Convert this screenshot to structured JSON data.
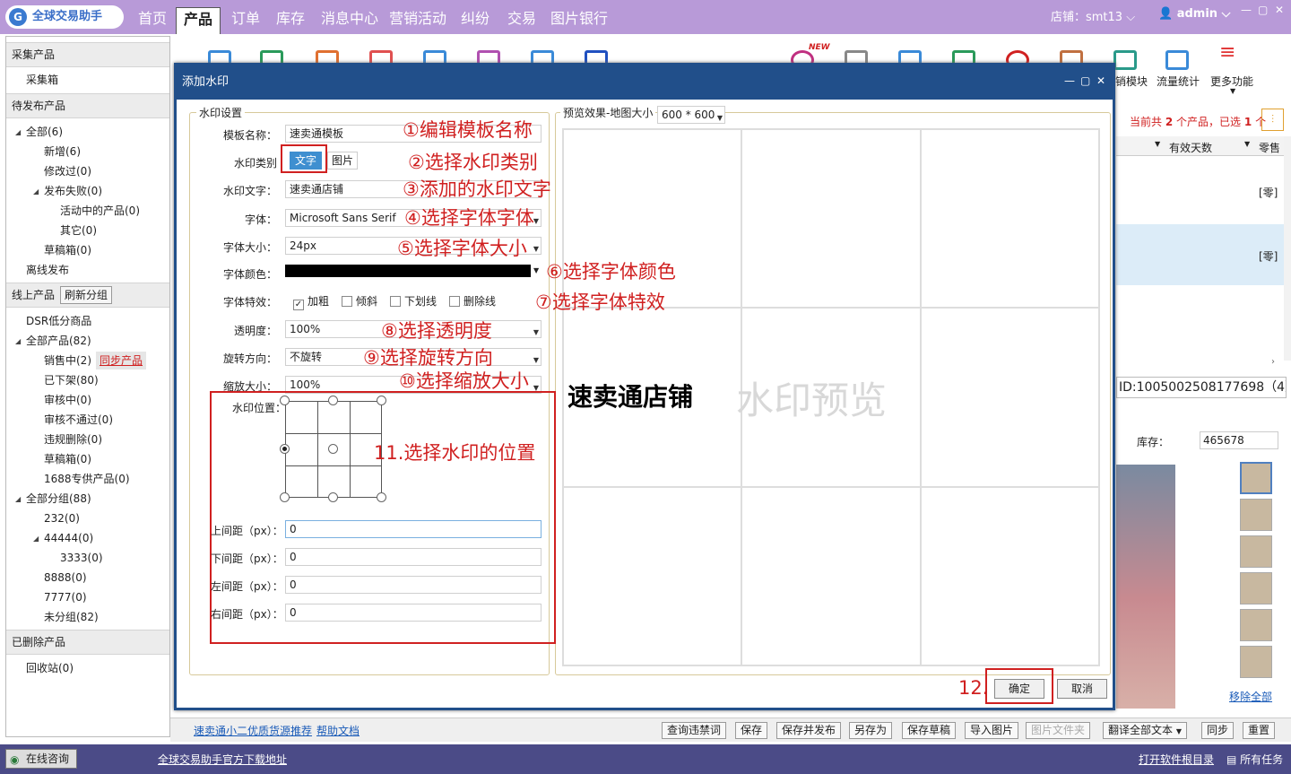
{
  "app": {
    "logo_text": "全球交易助手"
  },
  "nav": {
    "tabs": [
      {
        "label": "首页"
      },
      {
        "label": "产品"
      },
      {
        "label": "订单"
      },
      {
        "label": "库存"
      },
      {
        "label": "消息中心"
      },
      {
        "label": "营销活动"
      },
      {
        "label": "纠纷"
      },
      {
        "label": "交易"
      },
      {
        "label": "图片银行"
      }
    ]
  },
  "header": {
    "shop": "店铺：smt13",
    "user": "admin"
  },
  "sidebar": {
    "collect": {
      "title": "采集产品",
      "items": [
        "采集箱"
      ]
    },
    "pending": {
      "title": "待发布产品",
      "all": "全部(6)",
      "new": "新增(6)",
      "modified": "修改过(0)",
      "failed": "发布失败(0)",
      "active": "活动中的产品(0)",
      "other": "其它(0)",
      "draft": "草稿箱(0)",
      "offline": "离线发布"
    },
    "online": {
      "title": "线上产品",
      "refresh_btn": "刷新分组",
      "dsr": "DSR低分商品",
      "all": "全部产品(82)",
      "selling": "销售中(2)",
      "sync": "同步产品",
      "offshelf": "已下架(80)",
      "reviewing": "审核中(0)",
      "rejected": "审核不通过(0)",
      "violation": "违规删除(0)",
      "draft": "草稿箱(0)",
      "exclusive": "1688专供产品(0)",
      "groups_all": "全部分组(88)",
      "g232": "232(0)",
      "g44444": "44444(0)",
      "g3333": "3333(0)",
      "g8888": "8888(0)",
      "g7777": "7777(0)",
      "ungrouped": "未分组(82)"
    },
    "deleted": {
      "title": "已删除产品",
      "recycle": "回收站(0)"
    }
  },
  "toolbar": {
    "labels": [
      {
        "label": "销模块"
      },
      {
        "label": "流量统计"
      },
      {
        "label": "更多功能"
      }
    ],
    "new_badge": "NEW"
  },
  "product_list": {
    "summary_prefix": "当前共",
    "summary_count": "2",
    "summary_mid": "个产品，已选",
    "summary_sel": "1",
    "summary_suffix": "个",
    "col_valid": "有效天数",
    "col_zero": "零售",
    "row1": "[零]",
    "row2": "[零]",
    "product_id": "ID:1005002508177698（4）",
    "stock_label": "库存：",
    "stock_value": "465678",
    "remove_all": "移除全部"
  },
  "bottom": {
    "link1": "速卖通小二优质货源推荐",
    "link2": "帮助文档",
    "buttons": [
      {
        "label": "查询违禁词"
      },
      {
        "label": "保存"
      },
      {
        "label": "保存并发布"
      },
      {
        "label": "另存为"
      },
      {
        "label": "保存草稿"
      },
      {
        "label": "导入图片"
      },
      {
        "label": "图片文件夹"
      },
      {
        "label": "翻译全部文本"
      },
      {
        "label": "同步"
      },
      {
        "label": "重置"
      }
    ]
  },
  "statusbar": {
    "online": "在线咨询",
    "download": "全球交易助手官方下载地址",
    "open_dir": "打开软件根目录",
    "all_tasks": "所有任务"
  },
  "dialog": {
    "title": "添加水印",
    "left_legend": "水印设置",
    "right_legend": "预览效果-地图大小",
    "preview_size": "600 * 600",
    "fields": {
      "template_label": "模板名称：",
      "template_value": "速卖通模板",
      "type_label": "水印类别",
      "type_text": "文字",
      "type_image": "图片",
      "text_label": "水印文字：",
      "text_value": "速卖通店铺",
      "font_label": "字体：",
      "font_value": "Microsoft Sans Serif",
      "size_label": "字体大小：",
      "size_value": "24px",
      "color_label": "字体颜色：",
      "effect_label": "字体特效：",
      "bold": "加粗",
      "italic": "倾斜",
      "underline": "下划线",
      "strike": "删除线",
      "opacity_label": "透明度：",
      "opacity_value": "100%",
      "rotate_label": "旋转方向：",
      "rotate_value": "不旋转",
      "scale_label": "缩放大小：",
      "scale_value": "100%",
      "position_label": "水印位置：",
      "top_label": "上间距（px）：",
      "top_value": "0",
      "bottom_label": "下间距（px）：",
      "bottom_value": "0",
      "left_label": "左间距（px）：",
      "left_value": "0",
      "right_label": "右间距（px）：",
      "right_value": "0"
    },
    "preview_text": "速卖通店铺",
    "preview_placeholder": "水印预览",
    "ok": "确定",
    "cancel": "取消"
  },
  "annotations": {
    "a1": "①编辑模板名称",
    "a2": "②选择水印类别",
    "a3": "③添加的水印文字",
    "a4": "④选择字体字体",
    "a5": "⑤选择字体大小",
    "a6": "⑥选择字体颜色",
    "a7": "⑦选择字体特效",
    "a8": "⑧选择透明度",
    "a9": "⑨选择旋转方向",
    "a10": "⑩选择缩放大小",
    "a11": "11.选择水印的位置",
    "a12": "12."
  },
  "colors": {
    "nav_bg": "#b89ad8",
    "dialog_title": "#214f8a",
    "annotation": "#d02020",
    "status_bg": "#4b4b87"
  }
}
